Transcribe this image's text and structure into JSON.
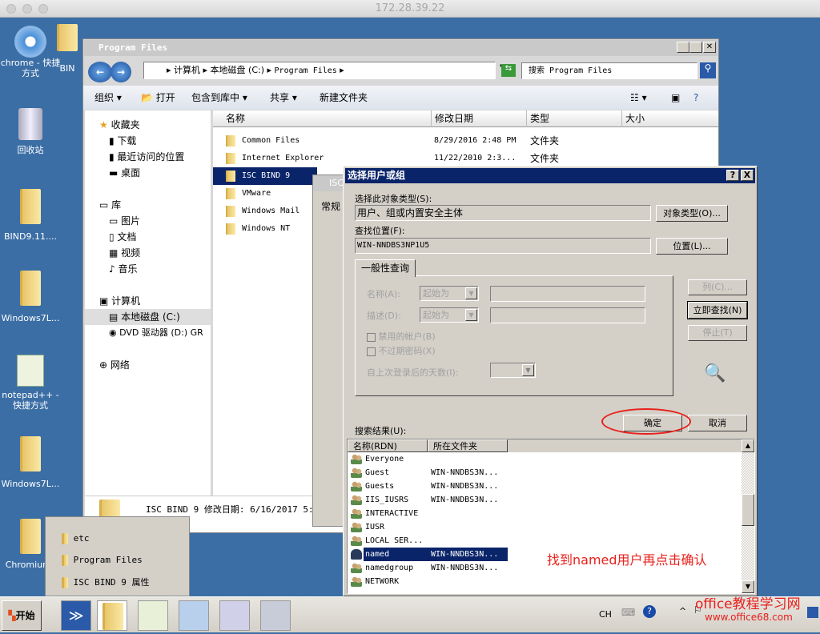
{
  "mac_title": "172.28.39.22",
  "desktop": {
    "icons": [
      {
        "label": "chrome - 快捷方式"
      },
      {
        "label": "BIN"
      },
      {
        "label": "回收站"
      },
      {
        "label": "BIND9.11...."
      },
      {
        "label": "Windows7L..."
      },
      {
        "label": "notepad++ - 快捷方式"
      },
      {
        "label": "Windows7L..."
      },
      {
        "label": "Chromium_"
      }
    ]
  },
  "explorer": {
    "title": "Program Files",
    "breadcrumb": [
      "计算机",
      "本地磁盘 (C:)",
      "Program Files"
    ],
    "search_placeholder": "搜索 Program Files",
    "toolbar": {
      "organize": "组织",
      "open": "打开",
      "include": "包含到库中",
      "share": "共享",
      "new_folder": "新建文件夹"
    },
    "nav": {
      "favorites": "收藏夹",
      "downloads": "下载",
      "recent": "最近访问的位置",
      "desktop": "桌面",
      "libraries": "库",
      "pictures": "图片",
      "documents": "文档",
      "videos": "视频",
      "music": "音乐",
      "computer": "计算机",
      "local_disk": "本地磁盘 (C:)",
      "dvd": "DVD 驱动器 (D:) GR",
      "network": "网络"
    },
    "columns": [
      "名称",
      "修改日期",
      "类型",
      "大小"
    ],
    "files": [
      {
        "name": "Common Files",
        "date": "8/29/2016 2:48 PM",
        "type": "文件夹"
      },
      {
        "name": "Internet Explorer",
        "date": "11/22/2010 2:3...",
        "type": "文件夹"
      },
      {
        "name": "ISC BIND 9",
        "date": "",
        "type": ""
      },
      {
        "name": "VMware",
        "date": "",
        "type": ""
      },
      {
        "name": "Windows Mail",
        "date": "",
        "type": ""
      },
      {
        "name": "Windows NT",
        "date": "",
        "type": ""
      }
    ],
    "details": "ISC BIND 9  修改日期: 6/16/2017 5:1"
  },
  "props_bg": {
    "title": "ISC",
    "tab": "常规"
  },
  "jumplist": [
    "etc",
    "Program Files",
    "ISC BIND 9 属性"
  ],
  "dialog": {
    "title": "选择用户或组",
    "help": "?",
    "close": "X",
    "obj_type_label": "选择此对象类型(S):",
    "obj_type_value": "用户、组或内置安全主体",
    "obj_type_btn": "对象类型(O)...",
    "location_label": "查找位置(F):",
    "location_value": "WIN-NNDBS3NP1U5",
    "location_btn": "位置(L)...",
    "tab": "一般性查询",
    "name_label": "名称(A):",
    "name_mode": "起始为",
    "desc_label": "描述(D):",
    "desc_mode": "起始为",
    "disabled_label": "禁用的帐户(B)",
    "noexpire_label": "不过期密码(X)",
    "days_label": "自上次登录后的天数(I):",
    "columns_btn": "列(C)...",
    "find_btn": "立即查找(N)",
    "stop_btn": "停止(T)",
    "ok_btn": "确定",
    "cancel_btn": "取消",
    "results_label": "搜索结果(U):",
    "result_cols": [
      "名称(RDN)",
      "所在文件夹"
    ],
    "results": [
      {
        "name": "Everyone",
        "folder": ""
      },
      {
        "name": "Guest",
        "folder": "WIN-NNDBS3N..."
      },
      {
        "name": "Guests",
        "folder": "WIN-NNDBS3N..."
      },
      {
        "name": "IIS_IUSRS",
        "folder": "WIN-NNDBS3N..."
      },
      {
        "name": "INTERACTIVE",
        "folder": ""
      },
      {
        "name": "IUSR",
        "folder": ""
      },
      {
        "name": "LOCAL SER...",
        "folder": ""
      },
      {
        "name": "named",
        "folder": "WIN-NNDBS3N...",
        "selected": true
      },
      {
        "name": "namedgroup",
        "folder": "WIN-NNDBS3N..."
      },
      {
        "name": "NETWORK",
        "folder": ""
      }
    ]
  },
  "annotation": "找到named用户再点击确认",
  "taskbar": {
    "start": "开始",
    "lang": "CH"
  },
  "watermark": {
    "line1": "office教程学习网",
    "line2": "www.office68.com"
  },
  "colors": {
    "desktop": "#3b6ea5",
    "dialog_title": "#0a246a",
    "annotation": "#e8201c"
  }
}
